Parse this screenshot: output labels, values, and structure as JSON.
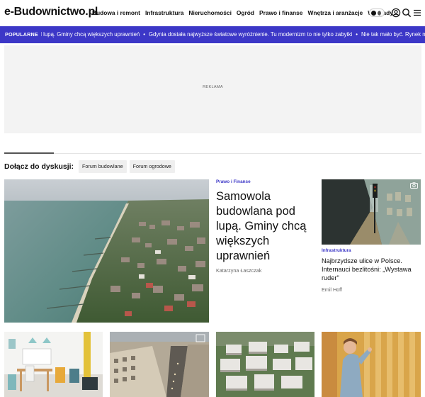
{
  "header": {
    "logo": "e-Budownictwo.pl",
    "nav": [
      "Budowa i remont",
      "Infrastruktura",
      "Nieruchomości",
      "Ogród",
      "Prawo i finanse",
      "Wnętrza i aranżacje",
      "Wywiady"
    ],
    "icons": [
      "theme-toggle-icon",
      "user-icon",
      "search-icon",
      "menu-icon"
    ]
  },
  "ticker": {
    "label": "POPULARNE",
    "items": [
      "pod lupą. Gminy chcą większych uprawnień",
      "Gdynia dostała najwyższe światowe wyróżnienie. Tu modernizm to nie tylko zabytki",
      "Nie tak mało być. Rynek mieszkań zaskoczy"
    ]
  },
  "ad": {
    "label": "REKLAMA"
  },
  "discussion": {
    "title": "Dołącz do dyskusji:",
    "chips": [
      "Forum budowlane",
      "Forum ogrodowe"
    ]
  },
  "main_article": {
    "category": "Prawo i Finanse",
    "title": "Samowola budowlana pod lupą. Gminy chcą większych uprawnień",
    "author": "Katarzyna Łaszczak"
  },
  "side_article": {
    "category": "Infrastruktura",
    "title": "Najbrzydsze ulice w Polsce. Internauci bezlitośni: „Wystawa ruder\"",
    "author": "Emil Hoff"
  }
}
